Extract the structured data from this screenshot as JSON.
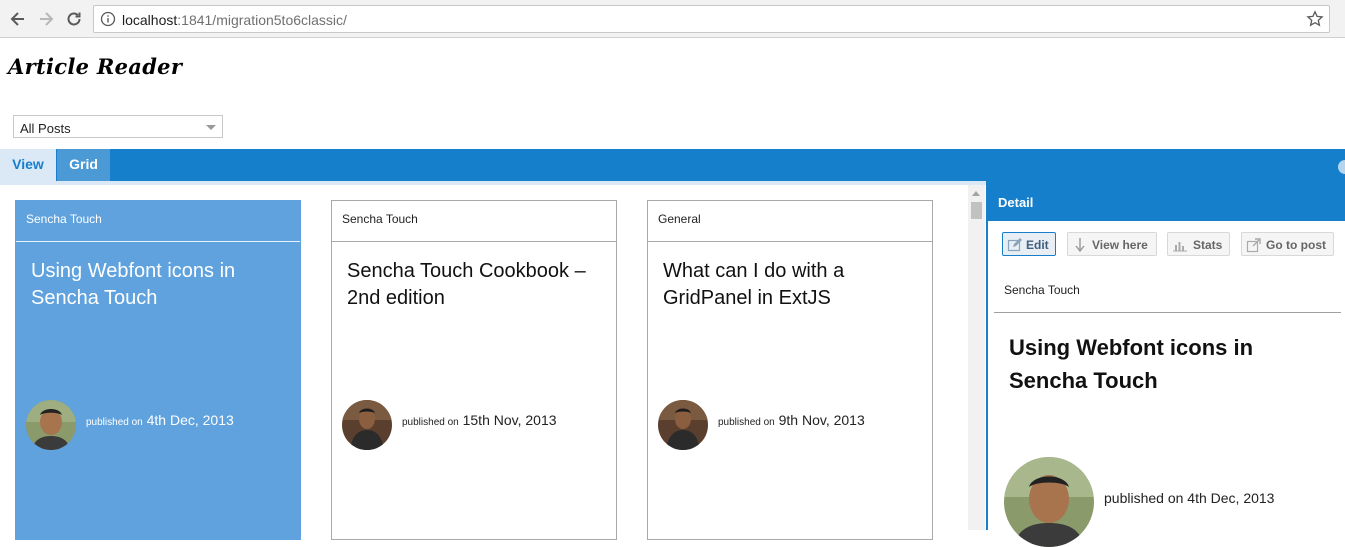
{
  "browser": {
    "url_host": "localhost",
    "url_rest": ":1841/migration5to6classic/"
  },
  "app": {
    "title": "Article Reader",
    "filter": {
      "selected": "All Posts"
    }
  },
  "tabs": [
    {
      "label": "View",
      "active": true
    },
    {
      "label": "Grid",
      "active": false
    }
  ],
  "cards": [
    {
      "category": "Sencha Touch",
      "title": "Using Webfont icons in Sencha Touch",
      "published_prefix": "published on",
      "date": "4th Dec, 2013",
      "selected": true
    },
    {
      "category": "Sencha Touch",
      "title": "Sencha Touch Cookbook – 2nd edition",
      "published_prefix": "published on",
      "date": "15th Nov, 2013",
      "selected": false
    },
    {
      "category": "General",
      "title": "What can I do with a GridPanel in ExtJS",
      "published_prefix": "published on",
      "date": "9th Nov, 2013",
      "selected": false
    }
  ],
  "detail": {
    "header": "Detail",
    "toolbar": {
      "edit": "Edit",
      "view_here": "View here",
      "stats": "Stats",
      "go_to_post": "Go to post"
    },
    "category": "Sencha Touch",
    "title": "Using Webfont icons in Sencha Touch",
    "published": "published on 4th Dec, 2013"
  },
  "colors": {
    "accent": "#157fcc",
    "selected_card": "#5fa2dd",
    "active_tab_bg": "#dbe9f6"
  }
}
